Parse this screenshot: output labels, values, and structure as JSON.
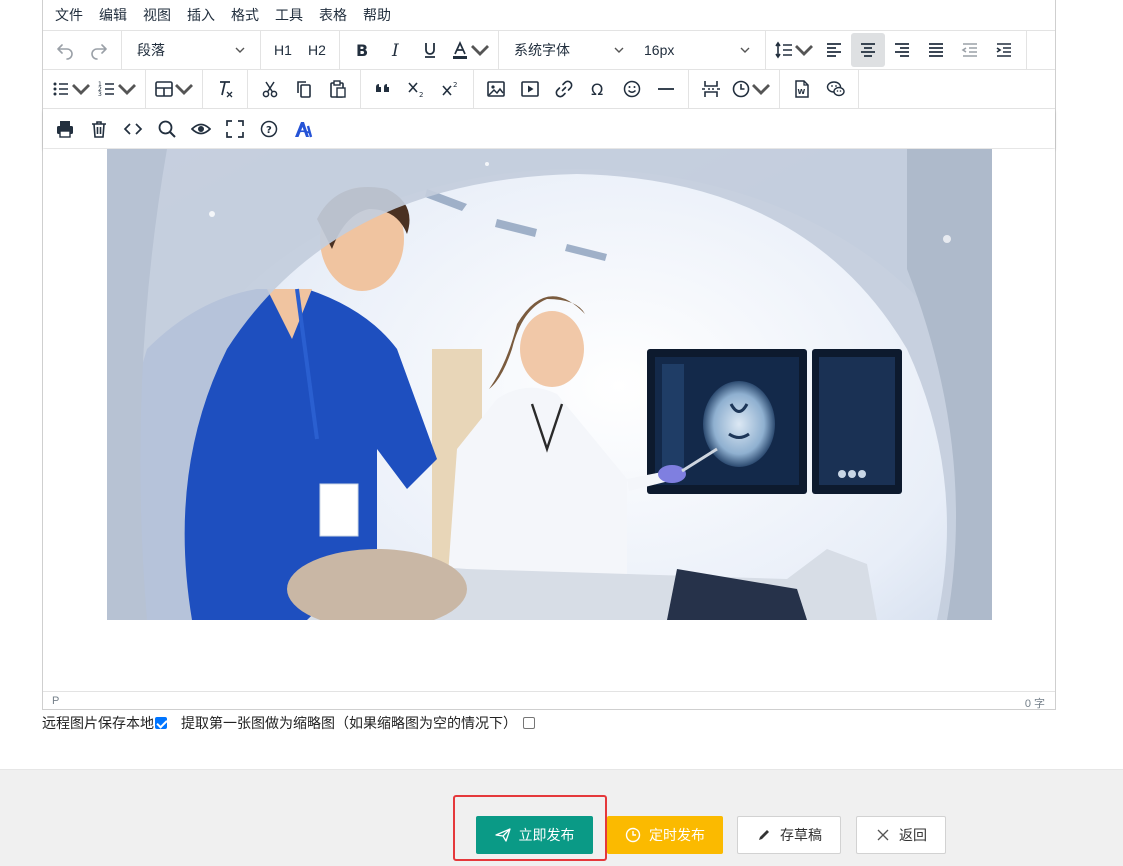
{
  "menubar": {
    "items": [
      "文件",
      "编辑",
      "视图",
      "插入",
      "格式",
      "工具",
      "表格",
      "帮助"
    ]
  },
  "toolbar": {
    "block_format": "段落",
    "h1": "H1",
    "h2": "H2",
    "font_family": "系统字体",
    "font_size": "16px"
  },
  "statusbar": {
    "path": "P",
    "word_count": "0 字"
  },
  "options": {
    "save_remote_images": "远程图片保存本地",
    "save_remote_images_checked": true,
    "extract_thumbnail": "提取第一张图做为缩略图（如果缩略图为空的情况下）",
    "extract_thumbnail_checked": false
  },
  "footer": {
    "publish_now": "立即发布",
    "scheduled_publish": "定时发布",
    "save_draft": "存草稿",
    "back": "返回"
  },
  "colors": {
    "publish_now": "#0a9a86",
    "scheduled_publish": "#fbba00",
    "highlight_box": "#e5383b",
    "ai_icon": "#2553d6"
  },
  "icons": [
    "undo-icon",
    "redo-icon",
    "bold-icon",
    "italic-icon",
    "underline-icon",
    "font-color-icon",
    "line-height-icon",
    "align-left-icon",
    "align-center-icon",
    "align-right-icon",
    "align-justify-icon",
    "outdent-icon",
    "indent-icon",
    "bullet-list-icon",
    "numbered-list-icon",
    "table-icon",
    "clear-format-icon",
    "cut-icon",
    "copy-icon",
    "paste-icon",
    "blockquote-icon",
    "subscript-icon",
    "superscript-icon",
    "image-icon",
    "media-icon",
    "link-icon",
    "special-char-icon",
    "emoticon-icon",
    "horizontal-rule-icon",
    "page-break-icon",
    "datetime-icon",
    "import-word-icon",
    "wechat-icon",
    "print-icon",
    "delete-icon",
    "source-code-icon",
    "search-icon",
    "preview-icon",
    "fullscreen-icon",
    "help-icon",
    "ai-icon"
  ]
}
